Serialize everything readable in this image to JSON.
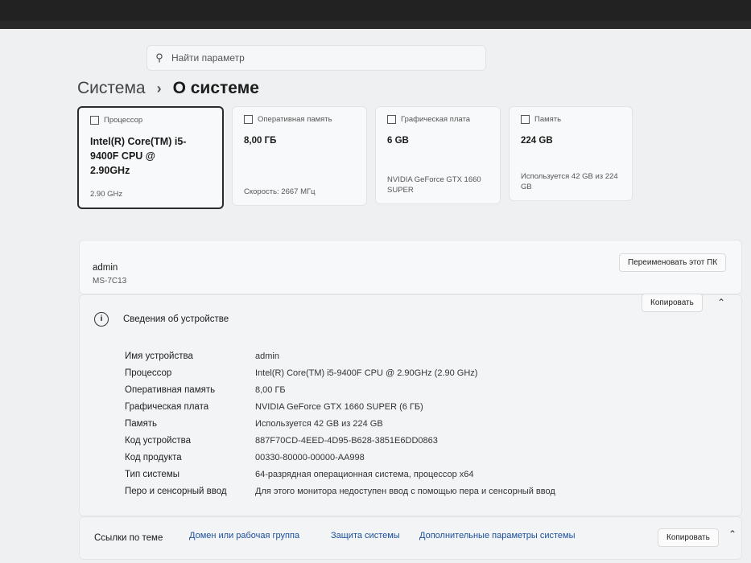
{
  "search": {
    "placeholder": "Найти параметр"
  },
  "breadcrumb": {
    "parent": "Система",
    "separator": "›",
    "current": "О системе"
  },
  "cards": [
    {
      "title": "Процессор",
      "value": "Intel(R) Core(TM) i5-9400F CPU @ 2.90GHz",
      "footer": "2.90 GHz"
    },
    {
      "title": "Оперативная память",
      "value": "8,00 ГБ",
      "footer": "Скорость: 2667 МГц"
    },
    {
      "title": "Графическая плата",
      "value": "6 GB",
      "footer": "NVIDIA GeForce GTX 1660 SUPER"
    },
    {
      "title": "Память",
      "value": "224 GB",
      "footer": "Используется 42 GB из 224 GB"
    }
  ],
  "pc": {
    "name": "admin",
    "model": "MS-7C13",
    "rename_label": "Переименовать этот ПК"
  },
  "device": {
    "title": "Сведения об устройстве",
    "copy_label": "Копировать",
    "rows": [
      {
        "key": "Имя устройства",
        "value": "admin"
      },
      {
        "key": "Процессор",
        "value": "Intel(R) Core(TM) i5-9400F CPU @ 2.90GHz (2.90 GHz)"
      },
      {
        "key": "Оперативная память",
        "value": "8,00 ГБ"
      },
      {
        "key": "Графическая плата",
        "value": "NVIDIA GeForce GTX 1660 SUPER (6 ГБ)"
      },
      {
        "key": "Память",
        "value": "Используется 42 GB из 224 GB"
      },
      {
        "key": "Код устройства",
        "value": "887F70CD-4EED-4D95-B628-3851E6DD0863"
      },
      {
        "key": "Код продукта",
        "value": "00330-80000-00000-AA998"
      },
      {
        "key": "Тип системы",
        "value": "64-разрядная операционная система, процессор x64"
      },
      {
        "key": "Перо и сенсорный ввод",
        "value": "Для этого монитора недоступен ввод с помощью пера и сенсорный ввод"
      }
    ]
  },
  "links": {
    "label": "Ссылки по теме",
    "items": [
      "Домен или рабочая группа",
      "Защита системы",
      "Дополнительные параметры системы"
    ],
    "copy_label": "Копировать"
  }
}
